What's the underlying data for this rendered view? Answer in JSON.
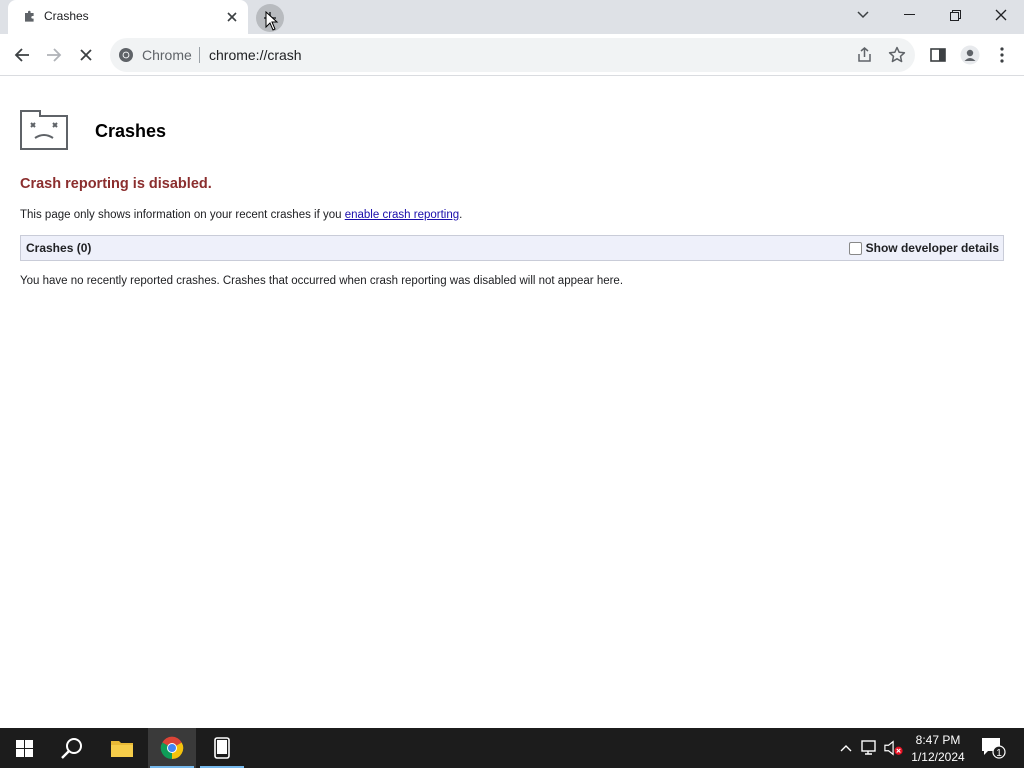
{
  "browser": {
    "tab": {
      "title": "Crashes"
    },
    "omnibox": {
      "chip_label": "Chrome",
      "url": "chrome://crash"
    }
  },
  "page": {
    "title": "Crashes",
    "status_heading": "Crash reporting is disabled.",
    "info_prefix": "This page only shows information on your recent crashes if you ",
    "info_link": "enable crash reporting",
    "info_suffix": ".",
    "crash_count_label": "Crashes (0)",
    "dev_details_label": "Show developer details",
    "dev_details_checked": false,
    "empty_message": "You have no recently reported crashes. Crashes that occurred when crash reporting was disabled will not appear here."
  },
  "taskbar": {
    "time": "8:47 PM",
    "date": "1/12/2024",
    "notification_count": "1"
  },
  "colors": {
    "status_heading": "#8b2e2e",
    "link": "#1a0dab",
    "crash_bar_bg": "#eef0fa",
    "taskbar_bg": "#1c1c1c",
    "tab_strip_bg": "#dee1e6"
  }
}
